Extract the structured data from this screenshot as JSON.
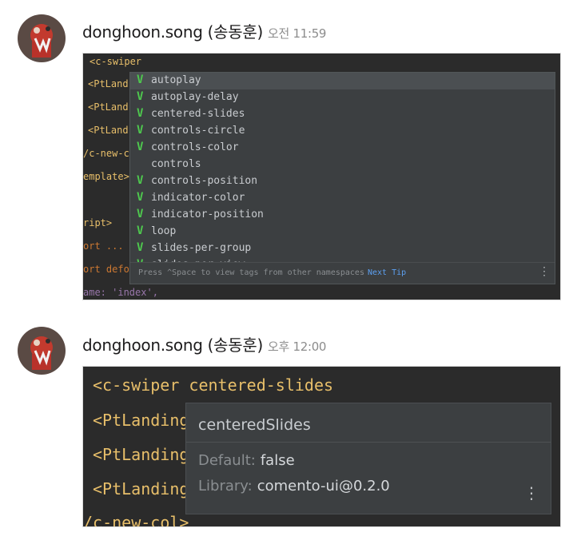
{
  "messages": [
    {
      "author": "donghoon.song (송동훈)",
      "time": "오전 11:59",
      "code_lines": [
        {
          "text": "<c-swiper",
          "color": "#e8bf6a"
        },
        {
          "text": "<PtLand",
          "color": "#e8bf6a"
        },
        {
          "text": "<PtLand",
          "color": "#e8bf6a"
        },
        {
          "text": "<PtLand",
          "color": "#e8bf6a"
        },
        {
          "text": "/c-new-c",
          "color": "#e8bf6a"
        },
        {
          "text": "emplate>",
          "color": "#e8bf6a"
        },
        {
          "text": "",
          "color": "#a9b7c6"
        },
        {
          "text": "ript>",
          "color": "#e8bf6a"
        },
        {
          "text": "ort ...",
          "color": "#cc7832"
        },
        {
          "text": "ort defo",
          "color": "#cc7832"
        },
        {
          "text": "ame: 'index',",
          "color": "#9876aa"
        }
      ],
      "completion_items": [
        {
          "label": "autoplay",
          "check": true
        },
        {
          "label": "autoplay-delay",
          "check": true
        },
        {
          "label": "centered-slides",
          "check": true
        },
        {
          "label": "controls-circle",
          "check": true
        },
        {
          "label": "controls-color",
          "check": true
        },
        {
          "label": "controls",
          "check": false
        },
        {
          "label": "controls-position",
          "check": true
        },
        {
          "label": "indicator-color",
          "check": true
        },
        {
          "label": "indicator-position",
          "check": true
        },
        {
          "label": "loop",
          "check": true
        },
        {
          "label": "slides-per-group",
          "check": true
        },
        {
          "label": "slides-per-view",
          "check": true
        }
      ],
      "check_glyph": "V",
      "footer_tip": "Press ^Space to view tags from other namespaces",
      "footer_link": "Next Tip",
      "menu_glyph": "⋮"
    },
    {
      "author": "donghoon.song (송동훈)",
      "time": "오후 12:00",
      "code_lines": [
        {
          "text": "<c-swiper centered-slides",
          "color": "#e8bf6a"
        },
        {
          "text": "<PtLanding",
          "color": "#e8bf6a"
        },
        {
          "text": "<PtLanding",
          "color": "#e8bf6a"
        },
        {
          "text": "<PtLanding",
          "color": "#e8bf6a"
        },
        {
          "text": "/c-new-col>",
          "color": "#e8bf6a"
        }
      ],
      "doc_popup": {
        "title": "centeredSlides",
        "default_label": "Default:",
        "default_value": "false",
        "library_label": "Library:",
        "library_value": "comento-ui@0.2.0"
      },
      "menu_glyph": "⋮"
    }
  ]
}
